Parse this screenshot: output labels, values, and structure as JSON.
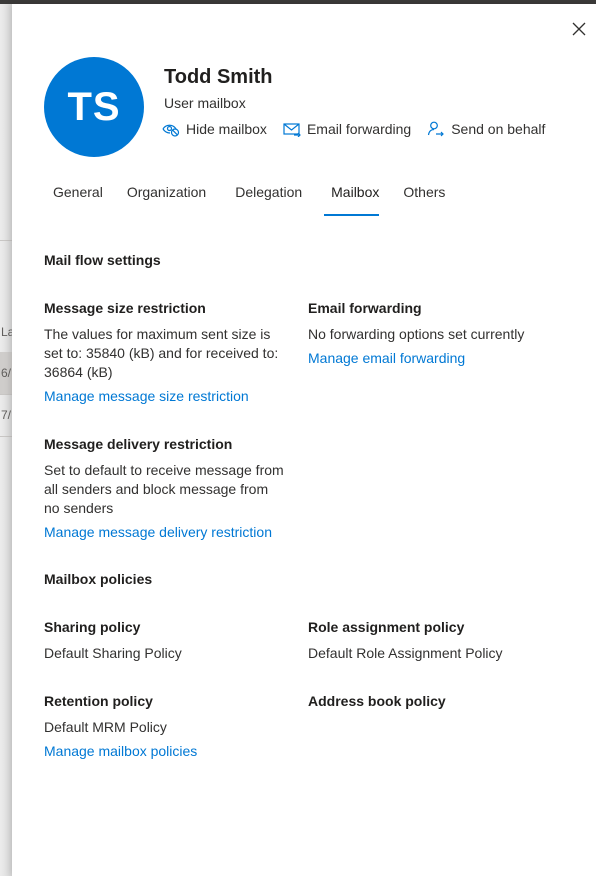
{
  "background": {
    "column_header_partial": "La",
    "rows_partial": [
      "6/",
      "7/"
    ]
  },
  "user": {
    "initials": "TS",
    "name": "Todd Smith",
    "type": "User mailbox",
    "avatar_color": "#0078d4"
  },
  "actions": [
    {
      "icon": "hide-mailbox-icon",
      "label": "Hide mailbox"
    },
    {
      "icon": "email-forwarding-icon",
      "label": "Email forwarding"
    },
    {
      "icon": "send-on-behalf-icon",
      "label": "Send on behalf"
    }
  ],
  "tabs": [
    {
      "label": "General",
      "active": false
    },
    {
      "label": "Organization",
      "active": false
    },
    {
      "label": "Delegation",
      "active": false
    },
    {
      "label": "Mailbox",
      "active": true
    },
    {
      "label": "Others",
      "active": false
    }
  ],
  "mail_flow": {
    "title": "Mail flow settings",
    "size_restriction": {
      "label": "Message size restriction",
      "lines": [
        "The values for maximum sent size is",
        "set to: 35840 (kB) and for received to:",
        "36864 (kB)"
      ],
      "link": "Manage message size restriction"
    },
    "email_forwarding": {
      "label": "Email forwarding",
      "text": "No forwarding options set currently",
      "link": "Manage email forwarding"
    },
    "delivery_restriction": {
      "label": "Message delivery restriction",
      "lines": [
        "Set to default to receive message from",
        "all senders and block message from",
        "no senders"
      ],
      "link": "Manage message delivery restriction"
    }
  },
  "policies": {
    "title": "Mailbox policies",
    "sharing": {
      "label": "Sharing policy",
      "value": "Default Sharing Policy"
    },
    "role_assignment": {
      "label": "Role assignment policy",
      "value": "Default Role Assignment Policy"
    },
    "retention": {
      "label": "Retention policy",
      "value": "Default MRM Policy"
    },
    "address_book": {
      "label": "Address book policy",
      "value": ""
    },
    "link": "Manage mailbox policies"
  },
  "colors": {
    "accent": "#0078d4",
    "text": "#323130"
  }
}
